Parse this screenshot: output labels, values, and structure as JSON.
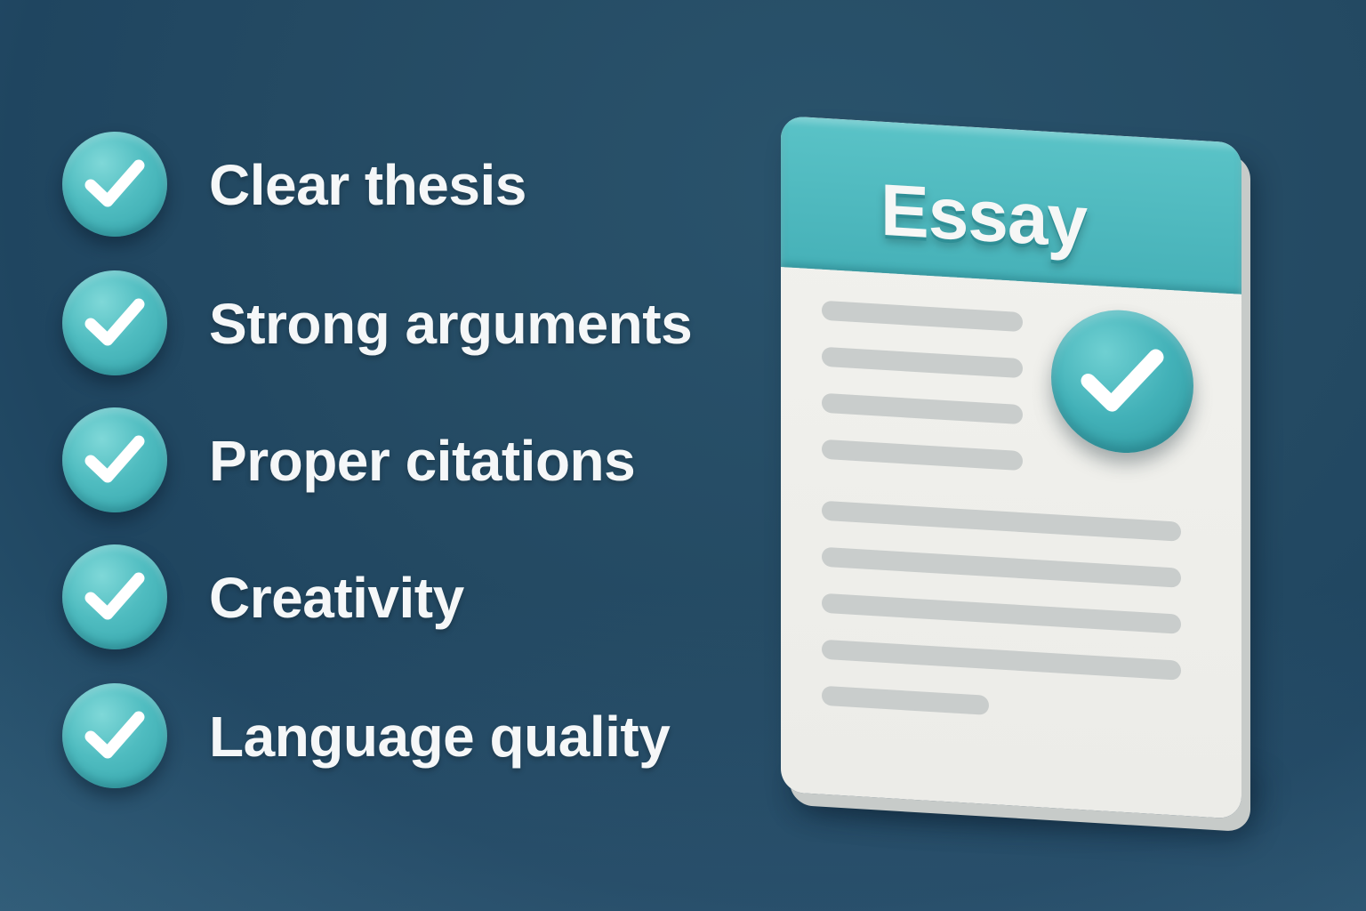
{
  "checklist": {
    "items": [
      {
        "label": "Clear thesis",
        "icon": "checkmark-icon"
      },
      {
        "label": "Strong arguments",
        "icon": "checkmark-icon"
      },
      {
        "label": "Proper citations",
        "icon": "checkmark-icon"
      },
      {
        "label": "Creativity",
        "icon": "checkmark-icon"
      },
      {
        "label": "Language quality",
        "icon": "checkmark-icon"
      }
    ]
  },
  "document": {
    "title": "Essay",
    "badge_icon": "checkmark-icon"
  },
  "colors": {
    "background": "#244a63",
    "accent": "#4fbcc0",
    "text": "#f5f7f8",
    "paper": "#efefeb",
    "placeholder_line": "#c9cdcc"
  }
}
